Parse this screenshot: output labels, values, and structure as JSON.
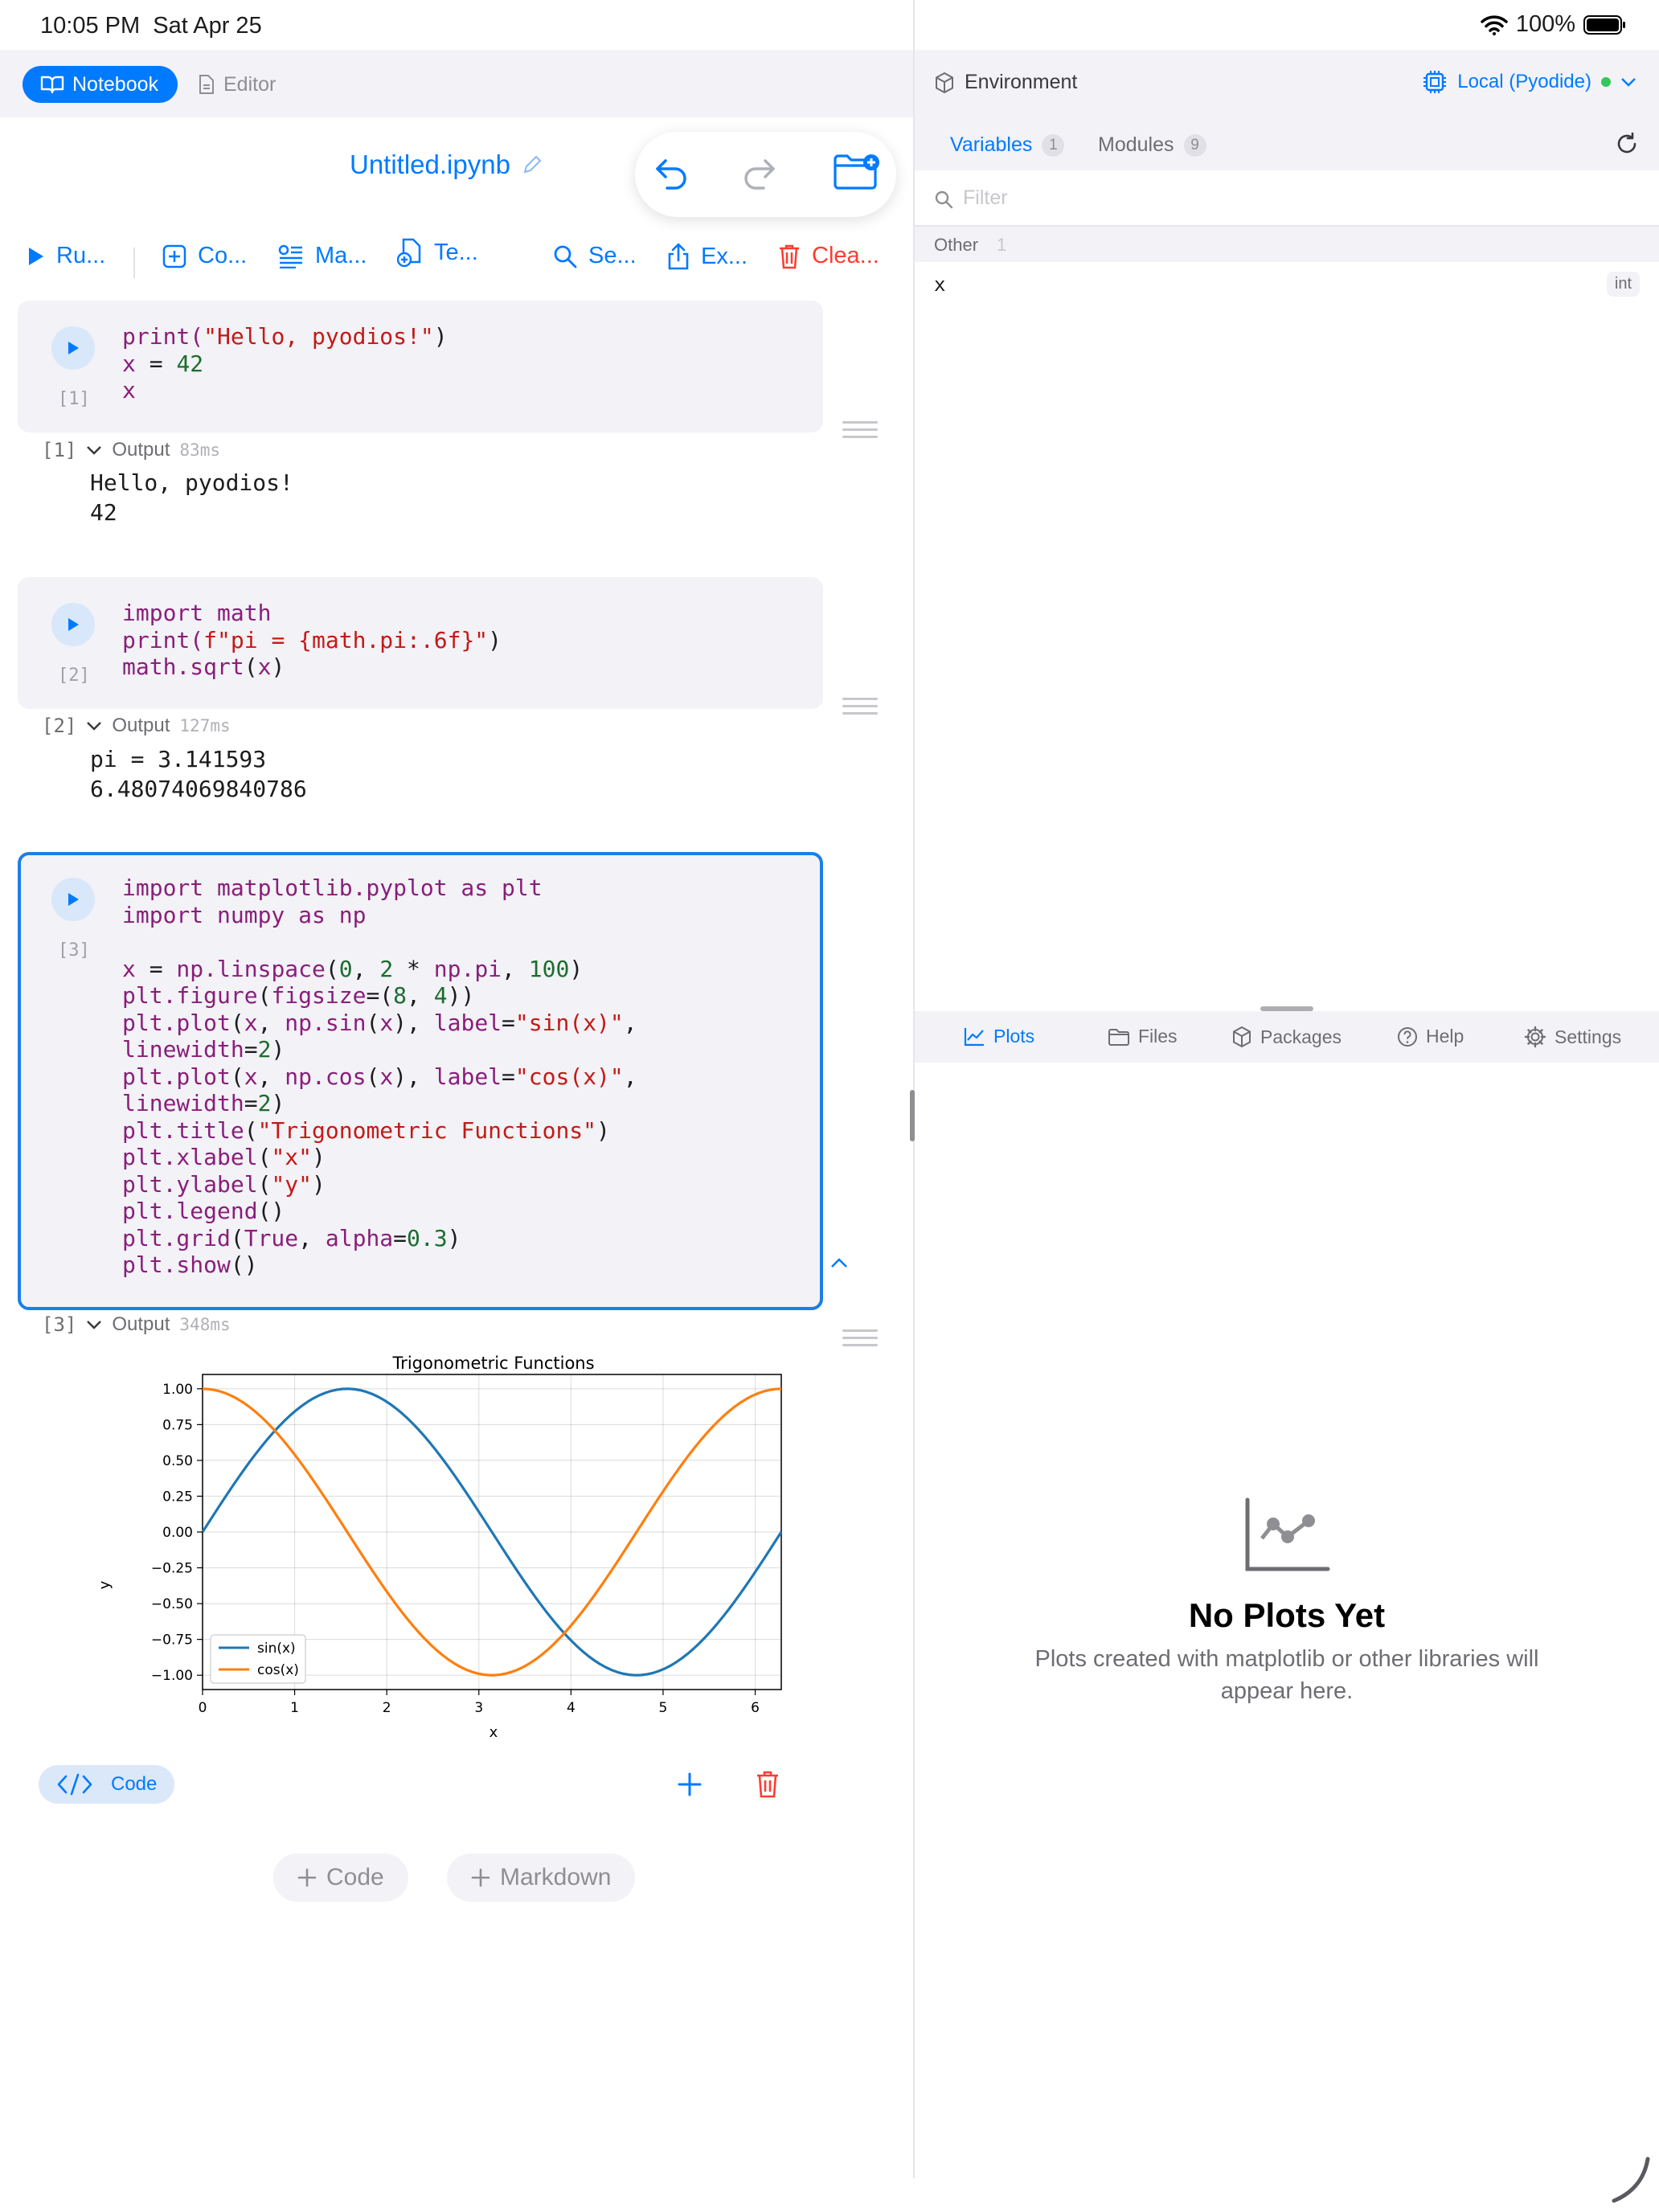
{
  "status": {
    "time": "10:05 PM",
    "date": "Sat Apr 25",
    "battery": "100%"
  },
  "topbar": {
    "notebook_label": "Notebook",
    "editor_label": "Editor"
  },
  "notebook": {
    "title": "Untitled.ipynb"
  },
  "toolbar": {
    "run": "Ru...",
    "code": "Co...",
    "markdown": "Ma...",
    "template": "Te...",
    "search": "Se...",
    "export": "Ex...",
    "clear": "Clea..."
  },
  "cells": [
    {
      "exec": "[1]",
      "lines": [
        "print(\"Hello, pyodios!\")",
        "x = 42",
        "x"
      ],
      "output_label": "Output",
      "output_time": "83ms",
      "output_lines": [
        "Hello, pyodios!",
        "",
        "42"
      ]
    },
    {
      "exec": "[2]",
      "lines": [
        "import math",
        "print(f\"pi = {math.pi:.6f}\")",
        "math.sqrt(x)"
      ],
      "output_label": "Output",
      "output_time": "127ms",
      "output_lines": [
        "pi = 3.141593",
        "",
        "6.48074069840786"
      ]
    },
    {
      "exec": "[3]",
      "lines": [
        "import matplotlib.pyplot as plt",
        "import numpy as np",
        "",
        "x = np.linspace(0, 2 * np.pi, 100)",
        "plt.figure(figsize=(8, 4))",
        "plt.plot(x, np.sin(x), label=\"sin(x)\",",
        "linewidth=2)",
        "plt.plot(x, np.cos(x), label=\"cos(x)\",",
        "linewidth=2)",
        "plt.title(\"Trigonometric Functions\")",
        "plt.xlabel(\"x\")",
        "plt.ylabel(\"y\")",
        "plt.legend()",
        "plt.grid(True, alpha=0.3)",
        "plt.show()"
      ],
      "output_label": "Output",
      "output_time": "348ms"
    }
  ],
  "chart_data": {
    "type": "line",
    "title": "Trigonometric Functions",
    "xlabel": "x",
    "ylabel": "y",
    "xlim": [
      0,
      6.2832
    ],
    "ylim": [
      -1.1,
      1.1
    ],
    "xticks": [
      "0",
      "1",
      "2",
      "3",
      "4",
      "5",
      "6"
    ],
    "yticks": [
      "1.00",
      "0.75",
      "0.50",
      "0.25",
      "0.00",
      "−0.25",
      "−0.50",
      "−0.75",
      "−1.00"
    ],
    "grid": true,
    "legend": "bottom-left",
    "series": [
      {
        "name": "sin(x)",
        "color": "#1f77b4",
        "function": "sin",
        "x_range": [
          0,
          6.2832
        ],
        "points": 100
      },
      {
        "name": "cos(x)",
        "color": "#ff7f0e",
        "function": "cos",
        "x_range": [
          0,
          6.2832
        ],
        "points": 100
      }
    ]
  },
  "cell_actions": {
    "code_chip": "Code",
    "add_code": "Code",
    "add_markdown": "Markdown"
  },
  "env": {
    "title": "Environment",
    "kernel": "Local (Pyodide)",
    "kernel_status_color": "#34c759"
  },
  "env_tabs": [
    {
      "label": "Variables",
      "count": "1"
    },
    {
      "label": "Modules",
      "count": "9"
    }
  ],
  "filter": {
    "placeholder": "Filter"
  },
  "variables": {
    "group_label": "Other",
    "group_count": "1",
    "items": [
      {
        "name": "x",
        "type": "int"
      }
    ]
  },
  "bottom_tabs": [
    "Plots",
    "Files",
    "Packages",
    "Help",
    "Settings"
  ],
  "plots_empty": {
    "title": "No Plots Yet",
    "subtitle_line1": "Plots created with matplotlib or other libraries will",
    "subtitle_line2": "appear here."
  },
  "colors": {
    "accent": "#007aff",
    "destructive": "#ff3b30",
    "selected_cell_border": "#1a7fe8"
  }
}
